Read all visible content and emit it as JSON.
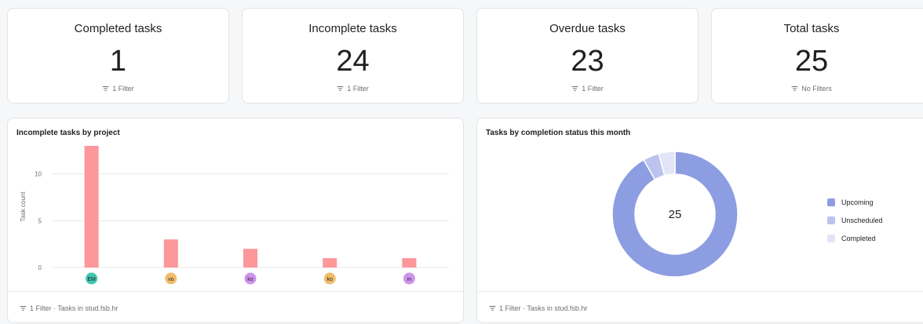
{
  "stats": [
    {
      "title": "Completed tasks",
      "value": "1",
      "filter": "1 Filter"
    },
    {
      "title": "Incomplete tasks",
      "value": "24",
      "filter": "1 Filter"
    },
    {
      "title": "Overdue tasks",
      "value": "23",
      "filter": "1 Filter"
    },
    {
      "title": "Total tasks",
      "value": "25",
      "filter": "No Filters"
    }
  ],
  "bar_panel": {
    "title": "Incomplete tasks by project",
    "footer": "1 Filter · Tasks in stud.fsb.hr"
  },
  "donut_panel": {
    "title": "Tasks by completion status this month",
    "center_value": "25",
    "footer": "1 Filter · Tasks in stud.fsb.hr"
  },
  "colors": {
    "bar": "#fc979a",
    "upcoming": "#8d9de2",
    "unscheduled": "#bcc3ee",
    "completed": "#e2e5f7"
  },
  "chart_data": [
    {
      "type": "bar",
      "title": "Incomplete tasks by project",
      "ylabel": "Task count",
      "xlabel": "",
      "categories": [
        "EM",
        "vo",
        "ko",
        "ko",
        "in"
      ],
      "category_colors": [
        "#3fc6b1",
        "#f1bd6c",
        "#cd95ea",
        "#f1bd6c",
        "#cd95ea"
      ],
      "values": [
        13,
        3,
        2,
        1,
        1
      ],
      "yticks": [
        0,
        5,
        10
      ],
      "ylim": [
        0,
        14
      ],
      "grid": true
    },
    {
      "type": "pie",
      "title": "Tasks by completion status this month",
      "categories": [
        "Upcoming",
        "Unscheduled",
        "Completed"
      ],
      "values": [
        22,
        1,
        1
      ],
      "total": 25,
      "legend": "right"
    }
  ]
}
